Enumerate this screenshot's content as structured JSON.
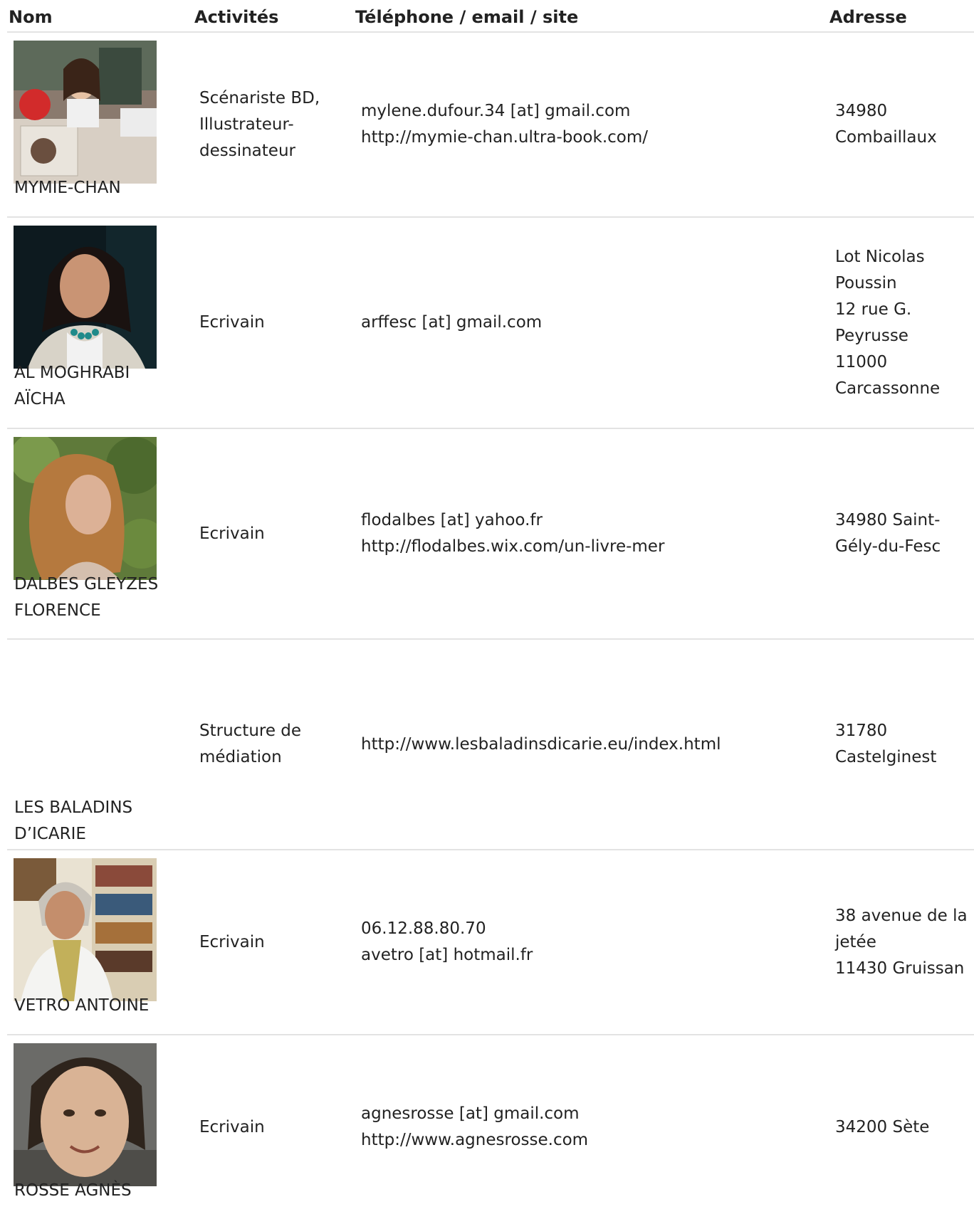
{
  "headers": {
    "nom": "Nom",
    "activites": "Activités",
    "contact": "Téléphone / email / site",
    "adresse": "Adresse"
  },
  "rows": [
    {
      "name_lines": [
        "MYMIE-CHAN"
      ],
      "activity_lines": [
        "Scénariste BD,",
        "Illustrateur-",
        "dessinateur"
      ],
      "contact_lines": [
        "mylene.dufour.34 [at] gmail.com",
        "http://mymie-chan.ultra-book.com/"
      ],
      "address_lines": [
        "34980",
        "Combaillaux"
      ],
      "photo_icon": "portrait-photo-festival"
    },
    {
      "name_lines": [
        "AL MOGHRABI",
        "AÏCHA"
      ],
      "activity_lines": [
        "Ecrivain"
      ],
      "contact_lines": [
        "arffesc [at] gmail.com"
      ],
      "address_lines": [
        "Lot Nicolas",
        "Poussin",
        "12 rue G.",
        "Peyrusse",
        "11000",
        "Carcassonne"
      ],
      "photo_icon": "portrait-photo-woman-dark-hair"
    },
    {
      "name_lines": [
        "DALBES GLEYZES",
        "FLORENCE"
      ],
      "activity_lines": [
        "Ecrivain"
      ],
      "contact_lines": [
        "flodalbes [at] yahoo.fr",
        "http://flodalbes.wix.com/un-livre-mer"
      ],
      "address_lines": [
        "34980 Saint-",
        "Gély-du-Fesc"
      ],
      "photo_icon": "portrait-photo-woman-curly-hair"
    },
    {
      "name_lines": [
        "LES BALADINS",
        "D’ICARIE"
      ],
      "activity_lines": [
        "Structure de",
        "médiation"
      ],
      "contact_lines": [
        "http://www.lesbaladinsdicarie.eu/index.html"
      ],
      "address_lines": [
        "31780",
        "Castelginest"
      ],
      "photo_icon": ""
    },
    {
      "name_lines": [
        "VETRO ANTOINE"
      ],
      "activity_lines": [
        "Ecrivain"
      ],
      "contact_lines": [
        "06.12.88.80.70",
        "avetro [at] hotmail.fr"
      ],
      "address_lines": [
        "38 avenue de la",
        "jetée",
        "11430 Gruissan"
      ],
      "photo_icon": "portrait-photo-man-bookshelf"
    },
    {
      "name_lines": [
        "ROSSE AGNÈS"
      ],
      "activity_lines": [
        "Ecrivain"
      ],
      "contact_lines": [
        "agnesrosse [at] gmail.com",
        "http://www.agnesrosse.com"
      ],
      "address_lines": [
        "34200 Sète"
      ],
      "photo_icon": "portrait-photo-woman-closeup"
    }
  ]
}
